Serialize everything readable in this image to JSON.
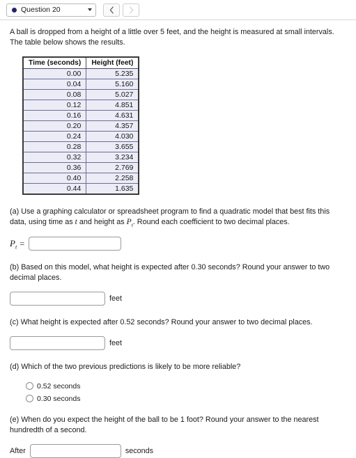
{
  "header": {
    "question_label": "Question 20",
    "dropdown_dot_color": "#24246b",
    "prev_icon": "chevron-left-icon",
    "next_icon": "chevron-right-icon"
  },
  "intro": "A ball is dropped from a height of a little over 5 feet, and the height is measured at small intervals. The table below shows the results.",
  "table": {
    "columns": [
      "Time (seconds)",
      "Height (feet)"
    ],
    "rows": [
      [
        "0.00",
        "5.235"
      ],
      [
        "0.04",
        "5.160"
      ],
      [
        "0.08",
        "5.027"
      ],
      [
        "0.12",
        "4.851"
      ],
      [
        "0.16",
        "4.631"
      ],
      [
        "0.20",
        "4.357"
      ],
      [
        "0.24",
        "4.030"
      ],
      [
        "0.28",
        "3.655"
      ],
      [
        "0.32",
        "3.234"
      ],
      [
        "0.36",
        "2.769"
      ],
      [
        "0.40",
        "2.258"
      ],
      [
        "0.44",
        "1.635"
      ]
    ]
  },
  "parts": {
    "a": {
      "prompt_1": "(a) Use a graphing calculator or spreadsheet program to find a quadratic model that best fits this data, using time as ",
      "var_t": "t",
      "prompt_2": " and height as ",
      "var_p": "P",
      "var_p_sub": "t",
      "prompt_3": ". Round each coefficient to two decimal places.",
      "answer_label_var": "P",
      "answer_label_sub": "t",
      "answer_equals": "=",
      "input_value": "",
      "input_placeholder": ""
    },
    "b": {
      "prompt": "(b) Based on this model, what height is expected after 0.30 seconds? Round your answer to two decimal places.",
      "input_value": "",
      "input_placeholder": "",
      "unit": "feet"
    },
    "c": {
      "prompt": "(c) What height is expected after 0.52 seconds? Round your answer to two decimal places.",
      "input_value": "",
      "input_placeholder": "",
      "unit": "feet"
    },
    "d": {
      "prompt": "(d) Which of the two previous predictions is likely to be more reliable?",
      "options": [
        {
          "label": "0.52 seconds",
          "selected": false
        },
        {
          "label": "0.30 seconds",
          "selected": false
        }
      ]
    },
    "e": {
      "prompt": "(e) When do you expect the height of the ball to be 1 foot? Round your answer to the nearest hundredth of a second.",
      "prefix": "After",
      "input_value": "",
      "input_placeholder": "",
      "unit": "seconds"
    }
  }
}
